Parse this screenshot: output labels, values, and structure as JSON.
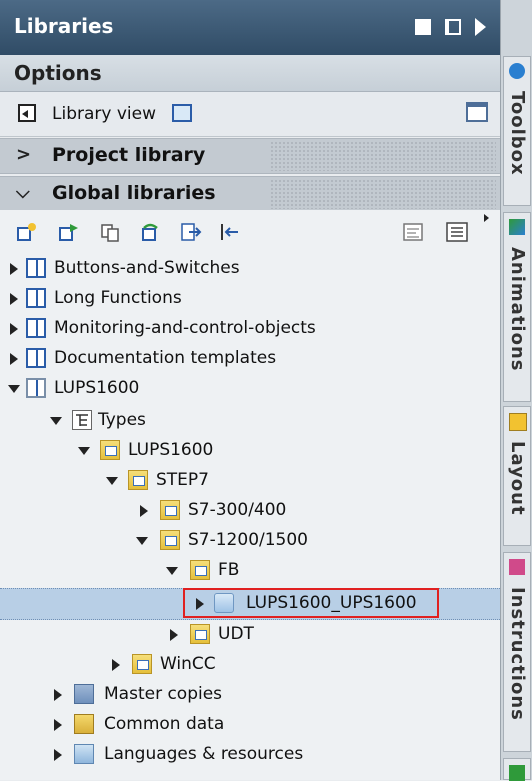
{
  "header": {
    "title": "Libraries"
  },
  "options": {
    "title": "Options"
  },
  "library_view": {
    "label": "Library view"
  },
  "sections": {
    "project": "Project library",
    "global": "Global libraries"
  },
  "tree": [
    {
      "label": "Buttons-and-Switches"
    },
    {
      "label": "Long Functions"
    },
    {
      "label": "Monitoring-and-control-objects"
    },
    {
      "label": "Documentation templates"
    },
    {
      "label": "LUPS1600"
    },
    {
      "label": "Types"
    },
    {
      "label": "LUPS1600"
    },
    {
      "label": "STEP7"
    },
    {
      "label": "S7-300/400"
    },
    {
      "label": "S7-1200/1500"
    },
    {
      "label": "FB"
    },
    {
      "label": "LUPS1600_UPS1600"
    },
    {
      "label": "UDT"
    },
    {
      "label": "WinCC"
    },
    {
      "label": "Master copies"
    },
    {
      "label": "Common data"
    },
    {
      "label": "Languages & resources"
    }
  ],
  "side_tabs": [
    "Toolbox",
    "Animations",
    "Layout",
    "Instructions"
  ],
  "colors": {
    "header": "#3a5a78",
    "selection": "#b8cfe6",
    "highlight_border": "#e02020"
  }
}
